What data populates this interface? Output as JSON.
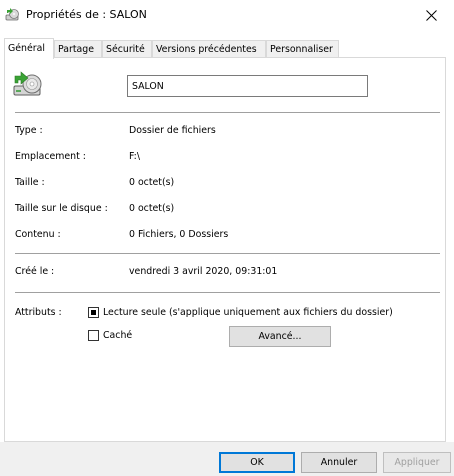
{
  "window": {
    "title": "Propriétés de : SALON",
    "icon": "drive-folder-icon",
    "close_icon": "close-icon"
  },
  "tabs": [
    {
      "label": "Général",
      "active": true
    },
    {
      "label": "Partage",
      "active": false
    },
    {
      "label": "Sécurité",
      "active": false
    },
    {
      "label": "Versions précédentes",
      "active": false
    },
    {
      "label": "Personnaliser",
      "active": false
    }
  ],
  "general": {
    "name_value": "SALON",
    "rows": [
      {
        "label": "Type :",
        "value": "Dossier de fichiers"
      },
      {
        "label": "Emplacement :",
        "value": "F:\\"
      },
      {
        "label": "Taille :",
        "value": "0 octet(s)"
      },
      {
        "label": "Taille sur le disque :",
        "value": "0 octet(s)"
      },
      {
        "label": "Contenu :",
        "value": "0 Fichiers, 0 Dossiers"
      }
    ],
    "created": {
      "label": "Créé le :",
      "value": "vendredi 3 avril 2020, 09:31:01"
    },
    "attributes": {
      "label": "Attributs :",
      "readonly_label": "Lecture seule (s'applique uniquement aux fichiers du dossier)",
      "readonly_checked": true,
      "hidden_label": "Caché",
      "hidden_checked": false,
      "advanced_button": "Avancé..."
    }
  },
  "buttons": {
    "ok": "OK",
    "cancel": "Annuler",
    "apply": "Appliquer"
  },
  "colors": {
    "accent": "#0078d7",
    "icon_green": "#3aa335"
  }
}
